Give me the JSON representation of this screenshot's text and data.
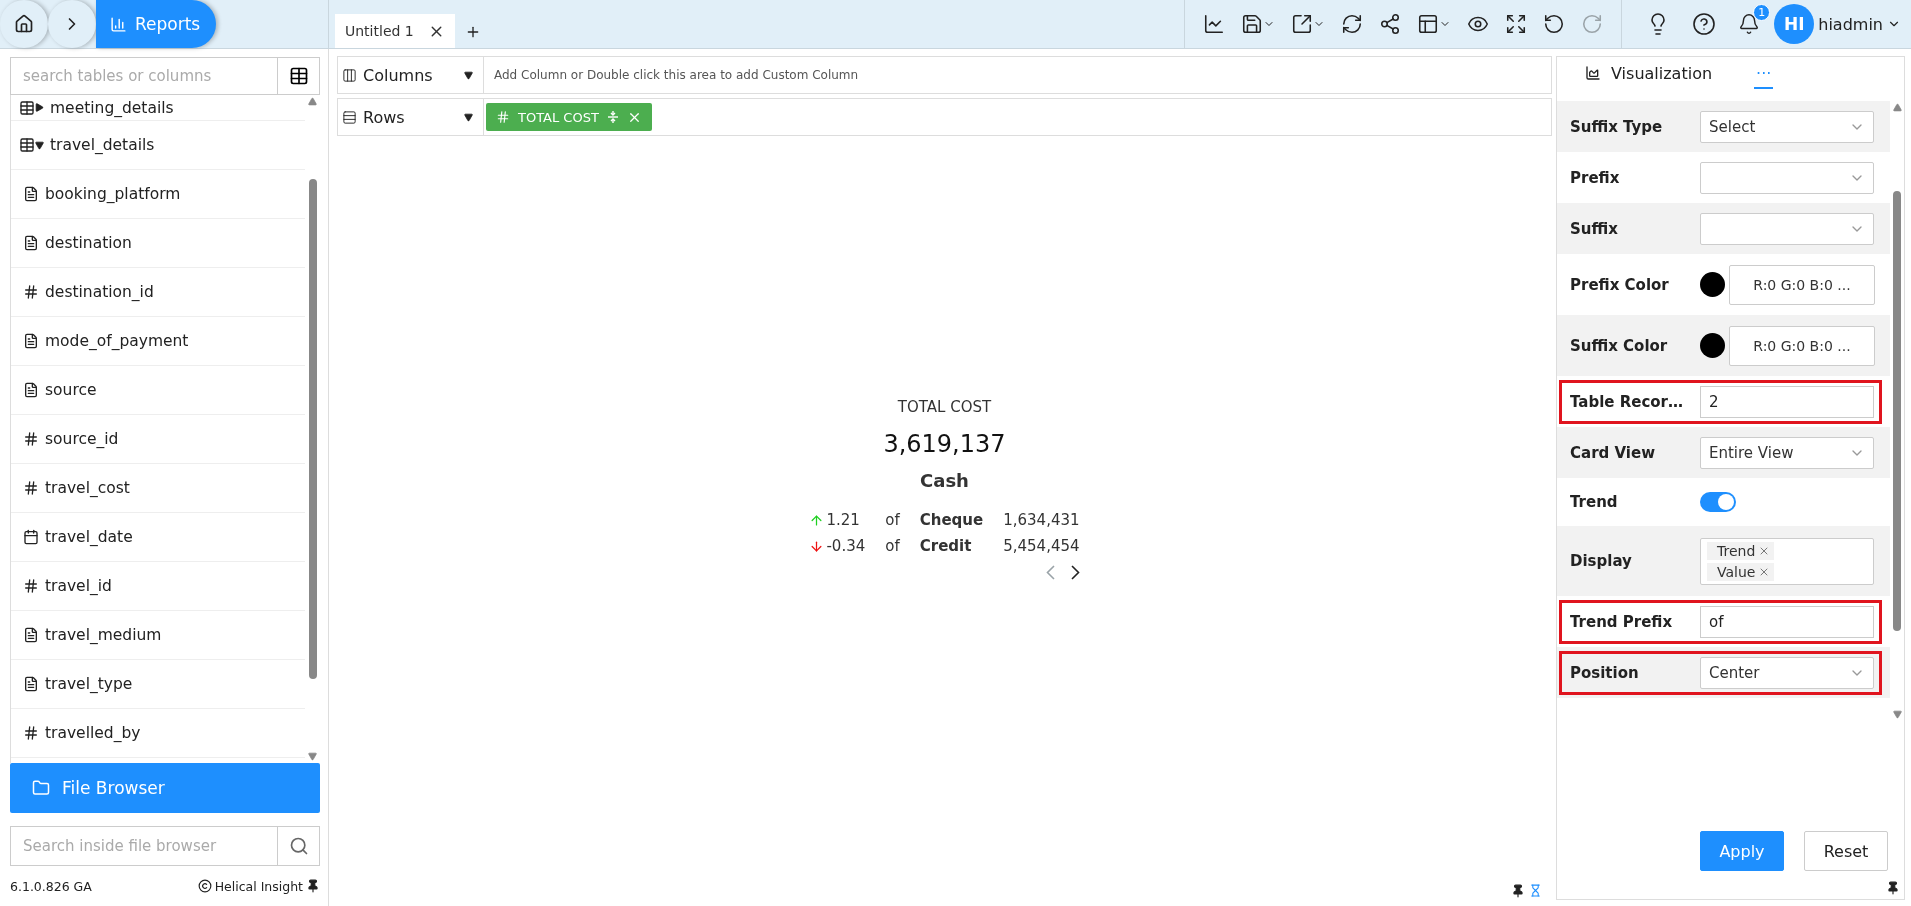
{
  "breadcrumb": {
    "current": "Reports"
  },
  "tabs": [
    {
      "label": "Untitled 1",
      "selected": true
    }
  ],
  "toolbar": [
    {
      "kind": "chart",
      "disabled": false
    },
    {
      "kind": "save",
      "disabled": false
    },
    {
      "kind": "export",
      "disabled": false
    },
    {
      "kind": "refresh",
      "disabled": false
    },
    {
      "kind": "share",
      "disabled": false
    },
    {
      "kind": "layout",
      "disabled": false
    },
    {
      "kind": "preview",
      "disabled": false
    },
    {
      "kind": "fullscreen",
      "disabled": false
    },
    {
      "kind": "undo",
      "disabled": false
    },
    {
      "kind": "redo",
      "disabled": true
    }
  ],
  "notifications": {
    "count": "1"
  },
  "user": {
    "initials": "HI",
    "name": "hiadmin"
  },
  "sidebar": {
    "search_placeholder": "search tables or columns",
    "tree": [
      {
        "label": "meeting_details",
        "kind": "table",
        "expanded": false
      },
      {
        "label": "travel_details",
        "kind": "table",
        "expanded": true,
        "children": [
          {
            "label": "booking_platform",
            "kind": "text"
          },
          {
            "label": "destination",
            "kind": "text"
          },
          {
            "label": "destination_id",
            "kind": "number"
          },
          {
            "label": "mode_of_payment",
            "kind": "text"
          },
          {
            "label": "source",
            "kind": "text"
          },
          {
            "label": "source_id",
            "kind": "number"
          },
          {
            "label": "travel_cost",
            "kind": "number"
          },
          {
            "label": "travel_date",
            "kind": "date"
          },
          {
            "label": "travel_id",
            "kind": "number"
          },
          {
            "label": "travel_medium",
            "kind": "text"
          },
          {
            "label": "travel_type",
            "kind": "text"
          },
          {
            "label": "travelled_by",
            "kind": "number"
          }
        ]
      }
    ],
    "file_browser": "File Browser",
    "file_search_placeholder": "Search inside file browser",
    "version": "6.1.0.826 GA",
    "brand": "Helical Insight"
  },
  "shelves": [
    {
      "kind": "columns",
      "label": "Columns",
      "hint": "Add Column or Double click this area to add Custom Column"
    },
    {
      "kind": "rows",
      "label": "Rows",
      "pills": [
        {
          "label": "TOTAL COST"
        }
      ]
    }
  ],
  "card": {
    "title": "TOTAL COST",
    "value": "3,619,137",
    "category": "Cash",
    "trends": [
      {
        "kind": "up",
        "change": "1.21",
        "prefix": "of",
        "label": "Cheque",
        "value": "1,634,431"
      },
      {
        "kind": "down",
        "change": "-0.34",
        "prefix": "of",
        "label": "Credit",
        "value": "5,454,454"
      }
    ],
    "pager": [
      {
        "kind": "prev",
        "disabled": true
      },
      {
        "kind": "next",
        "disabled": false
      }
    ]
  },
  "panel": {
    "tabs": [
      {
        "label": "Visualization",
        "kind": "chart",
        "selected": false
      },
      {
        "label": "···",
        "kind": "more",
        "selected": true
      }
    ],
    "settings": [
      {
        "label": "Suffix Type",
        "kind": "select",
        "value": "Select",
        "highlighted": false
      },
      {
        "label": "Prefix",
        "kind": "select",
        "highlighted": false
      },
      {
        "label": "Suffix",
        "kind": "select",
        "highlighted": false
      },
      {
        "label": "Prefix Color",
        "kind": "color",
        "value": "R:0 G:0 B:0 ...",
        "color": "#000000",
        "highlighted": false
      },
      {
        "label": "Suffix Color",
        "kind": "color",
        "value": "R:0 G:0 B:0 ...",
        "color": "#000000",
        "highlighted": false
      },
      {
        "label": "Table Recor…",
        "kind": "input",
        "value": "2",
        "highlighted": true
      },
      {
        "label": "Card View",
        "kind": "select",
        "value": "Entire View",
        "highlighted": false
      },
      {
        "label": "Trend",
        "kind": "toggle",
        "on": true,
        "highlighted": false
      },
      {
        "label": "Display",
        "kind": "tags",
        "tags": [
          "Trend",
          "Value"
        ],
        "highlighted": false
      },
      {
        "label": "Trend Prefix",
        "kind": "input",
        "value": "of",
        "highlighted": true
      },
      {
        "label": "Position",
        "kind": "select",
        "value": "Center",
        "highlighted": true
      }
    ],
    "buttons": [
      {
        "label": "Apply",
        "kind": "primary"
      },
      {
        "label": "Reset",
        "kind": "secondary"
      }
    ]
  }
}
